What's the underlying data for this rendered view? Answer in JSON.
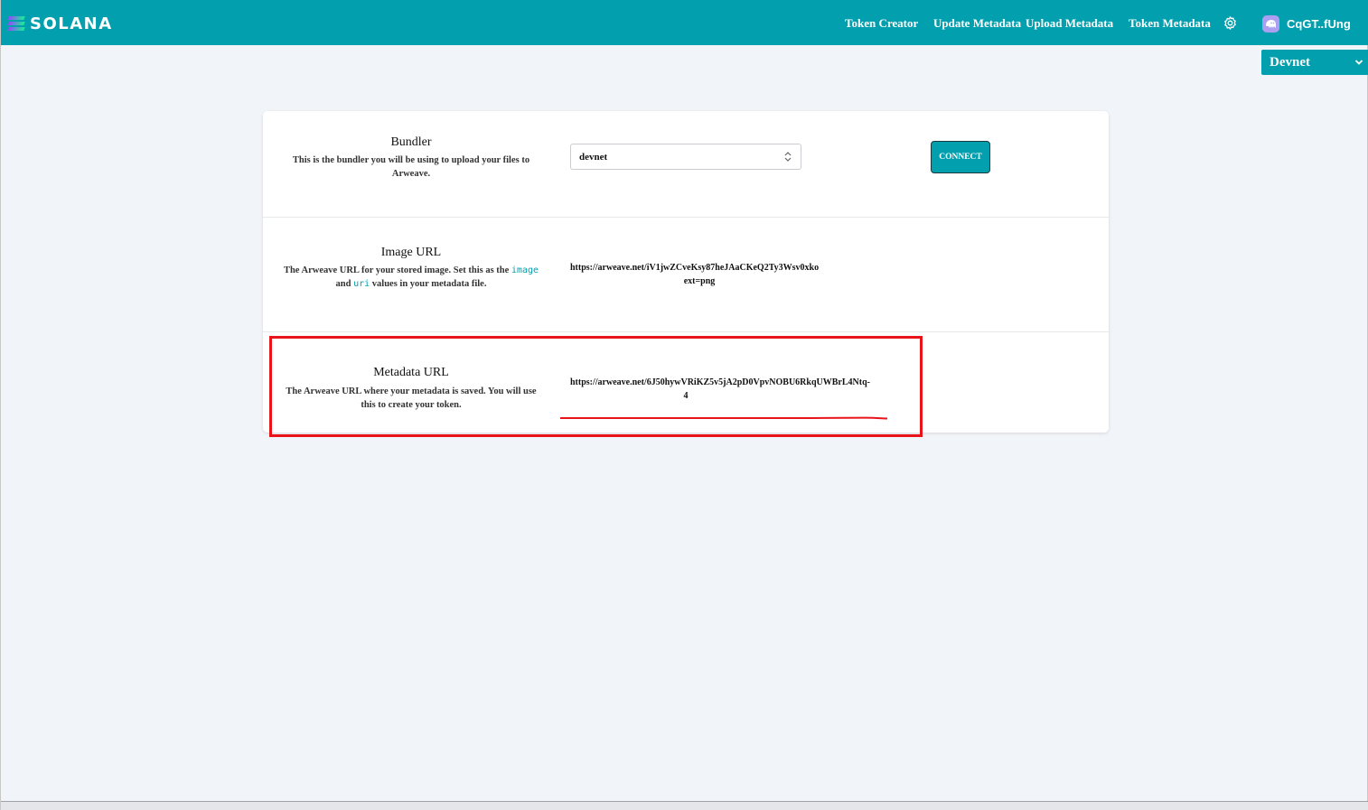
{
  "brand": {
    "name": "SOLANA"
  },
  "nav": {
    "items": [
      "Token Creator",
      "Update Metadata",
      "Upload Metadata",
      "Token Metadata"
    ],
    "settings_icon": "gear-icon",
    "wallet_label": "CqGT..fUng",
    "wallet_icon": "phantom-wallet-icon"
  },
  "network": {
    "selected": "Devnet"
  },
  "bundler": {
    "title": "Bundler",
    "description": "This is the bundler you will be using to upload your files to Arweave.",
    "select_value": "devnet",
    "connect_label": "CONNECT"
  },
  "image_url": {
    "title": "Image URL",
    "desc_part1": "The Arweave URL for your stored image. Set this as the ",
    "code1": "image",
    "desc_part2": " and ",
    "code2": "uri",
    "desc_part3": " values in your metadata file.",
    "url_line1": "https://arweave.net/iV1jwZCveKsy87heJAaCKeQ2Ty3Wsv0xko",
    "url_line2": "ext=png"
  },
  "metadata_url": {
    "title": "Metadata URL",
    "description": "The Arweave URL where your metadata is saved. You will use this to create your token.",
    "url_line1": "https://arweave.net/6J50hywVRiKZ5v5jA2pD0VpvNOBU6RkqUWBrL4Ntq-",
    "url_line2": "4"
  },
  "colors": {
    "accent": "#029fae",
    "highlight": "#e8141a",
    "background": "#f1f4f8"
  }
}
